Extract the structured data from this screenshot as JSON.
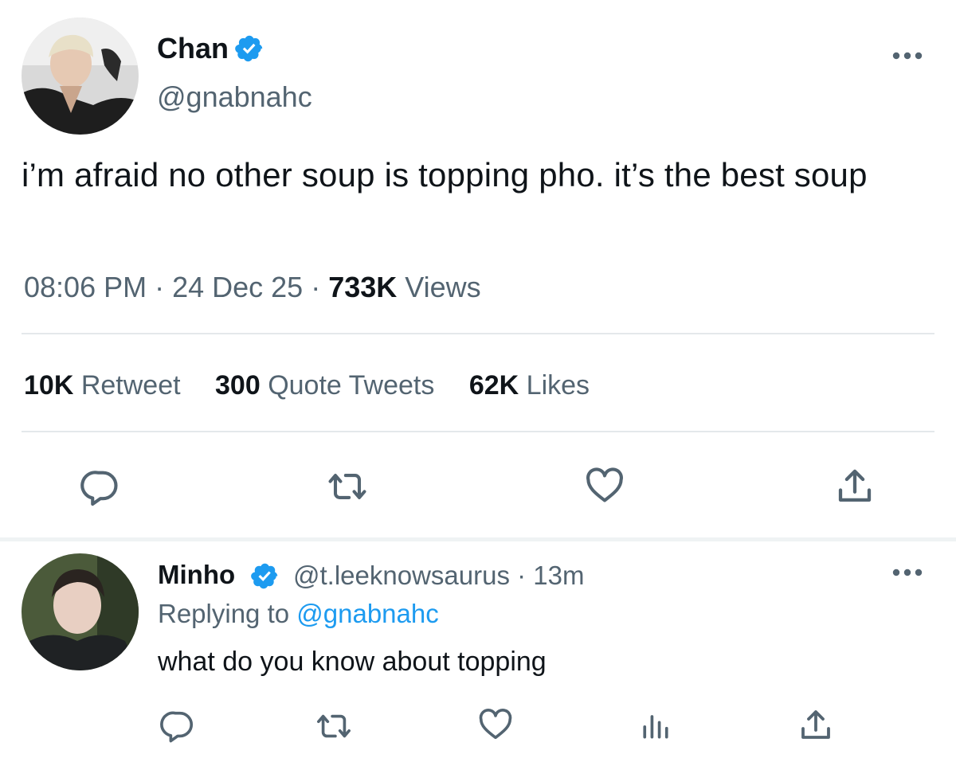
{
  "tweet": {
    "author": {
      "name": "Chan",
      "handle": "@gnabnahc",
      "verified": true
    },
    "text": "i’m afraid no other soup is topping pho. it’s the best soup",
    "time": "08:06 PM",
    "sep1": " · ",
    "date": "24 Dec 25",
    "sep2": " · ",
    "views_count": "733K",
    "views_label": "Views",
    "stats": {
      "retweets_count": "10K",
      "retweets_label": "Retweet",
      "quotes_count": "300",
      "quotes_label": "Quote Tweets",
      "likes_count": "62K",
      "likes_label": "Likes"
    },
    "actions": [
      "reply-icon",
      "retweet-icon",
      "like-icon",
      "share-icon"
    ]
  },
  "reply": {
    "author": {
      "name": "Minho",
      "handle": "@t.leeknowsaurus",
      "sep": " · ",
      "time": "13m",
      "verified": true
    },
    "replying_prefix": "Replying to ",
    "replying_handle": "@gnabnahc",
    "text": "what do you know about topping",
    "actions": [
      "reply-icon",
      "retweet-icon",
      "like-icon",
      "analytics-icon",
      "share-icon"
    ]
  },
  "colors": {
    "text": "#0f1419",
    "secondary": "#536471",
    "link": "#1d9bf0",
    "verified": "#1d9bf0",
    "divider": "#e4e8eb"
  }
}
